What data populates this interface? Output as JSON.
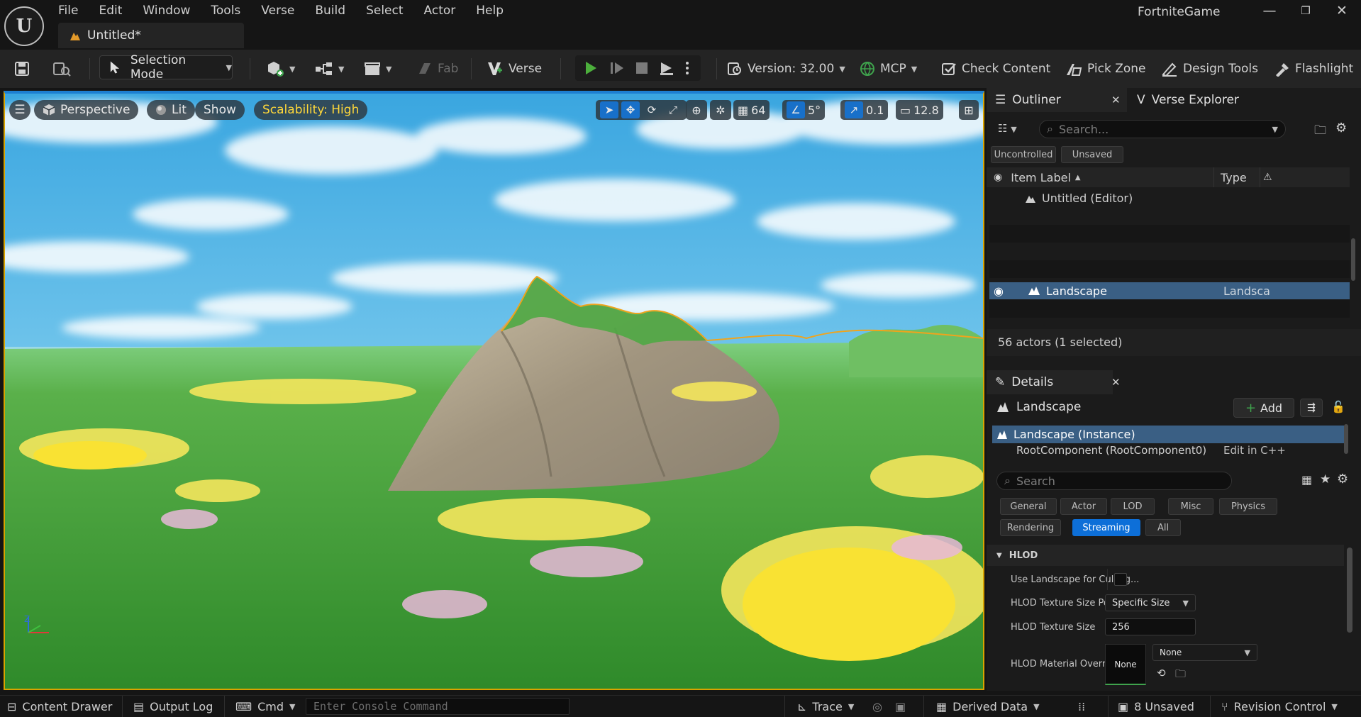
{
  "app": {
    "logo_glyph": "U",
    "menus": [
      "File",
      "Edit",
      "Window",
      "Tools",
      "Verse",
      "Build",
      "Select",
      "Actor",
      "Help"
    ],
    "document_tab": "Untitled*",
    "project_name": "FortniteGame",
    "window_buttons": {
      "minimize": "—",
      "restore": "❐",
      "close": "✕"
    }
  },
  "toolbar": {
    "selection_mode": "Selection Mode",
    "fab": "Fab",
    "verse": "Verse",
    "version": "Version: 32.00",
    "mcp": "MCP",
    "check_content": "Check Content",
    "pick_zone": "Pick Zone",
    "design_tools": "Design Tools",
    "flashlight": "Flashlight"
  },
  "viewport": {
    "perspective": "Perspective",
    "lit": "Lit",
    "show": "Show",
    "scalability": "Scalability: High",
    "grid_snap": "64",
    "rotation_snap": "5°",
    "scale_snap": "0.1",
    "camera_speed": "12.8",
    "axis_label": "Z"
  },
  "outliner": {
    "tab": "Outliner",
    "verse_tab": "Verse Explorer",
    "search_placeholder": "Search...",
    "filters": [
      "Uncontrolled",
      "Unsaved"
    ],
    "col_label": "Item Label",
    "col_type": "Type",
    "root_item": "Untitled (Editor)",
    "selected_item": "Landscape",
    "selected_type": "Landsca",
    "actor_count": "56 actors (1 selected)"
  },
  "details": {
    "tab": "Details",
    "actor_name": "Landscape",
    "add_button": "Add",
    "instance": "Landscape (Instance)",
    "component": "RootComponent (RootComponent0)",
    "component_note": "Edit in C++",
    "search_placeholder": "Search",
    "filter_chips_row1": [
      "General",
      "Actor",
      "LOD",
      "Misc",
      "Physics"
    ],
    "filter_chips_row2": [
      "Rendering",
      "Streaming",
      "All"
    ],
    "active_chip": "Streaming",
    "section": "HLOD",
    "properties": {
      "use_landscape_culling": "Use Landscape for Culling...",
      "texture_size_policy_label": "HLOD Texture Size Policy",
      "texture_size_policy_value": "Specific Size",
      "texture_size_label": "HLOD Texture Size",
      "texture_size_value": "256",
      "material_override_label": "HLOD Material Override",
      "material_thumb": "None",
      "material_value": "None"
    }
  },
  "statusbar": {
    "content_drawer": "Content Drawer",
    "output_log": "Output Log",
    "cmd": "Cmd",
    "console_placeholder": "Enter Console Command",
    "trace": "Trace",
    "derived_data": "Derived Data",
    "unsaved": "8 Unsaved",
    "revision_control": "Revision Control"
  },
  "colors": {
    "accent_blue": "#0d6fd8",
    "selection_yellow": "#d9a300",
    "play_green": "#4caf3c",
    "panel_bg": "#1b1b1b"
  }
}
